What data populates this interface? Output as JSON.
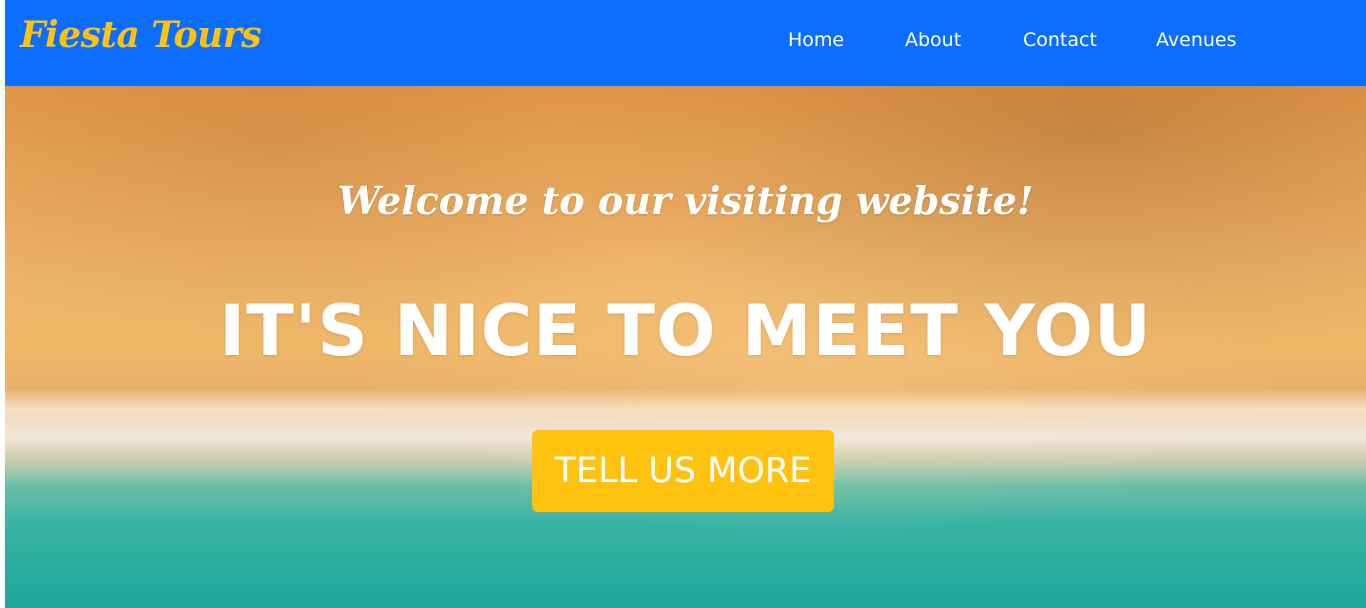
{
  "navbar": {
    "brand": "Fiesta Tours",
    "links": [
      "Home",
      "About",
      "Contact",
      "Avenues"
    ]
  },
  "hero": {
    "welcome": "Welcome to our visiting website!",
    "headline": "IT'S NICE TO MEET YOU",
    "cta_label": "TELL US MORE",
    "background_image": "aerial-beach-photo"
  },
  "colors": {
    "navbar_bg": "#0d6efd",
    "brand": "#fec20f",
    "cta_bg": "#fec20f",
    "nav_text": "#ffffff"
  }
}
